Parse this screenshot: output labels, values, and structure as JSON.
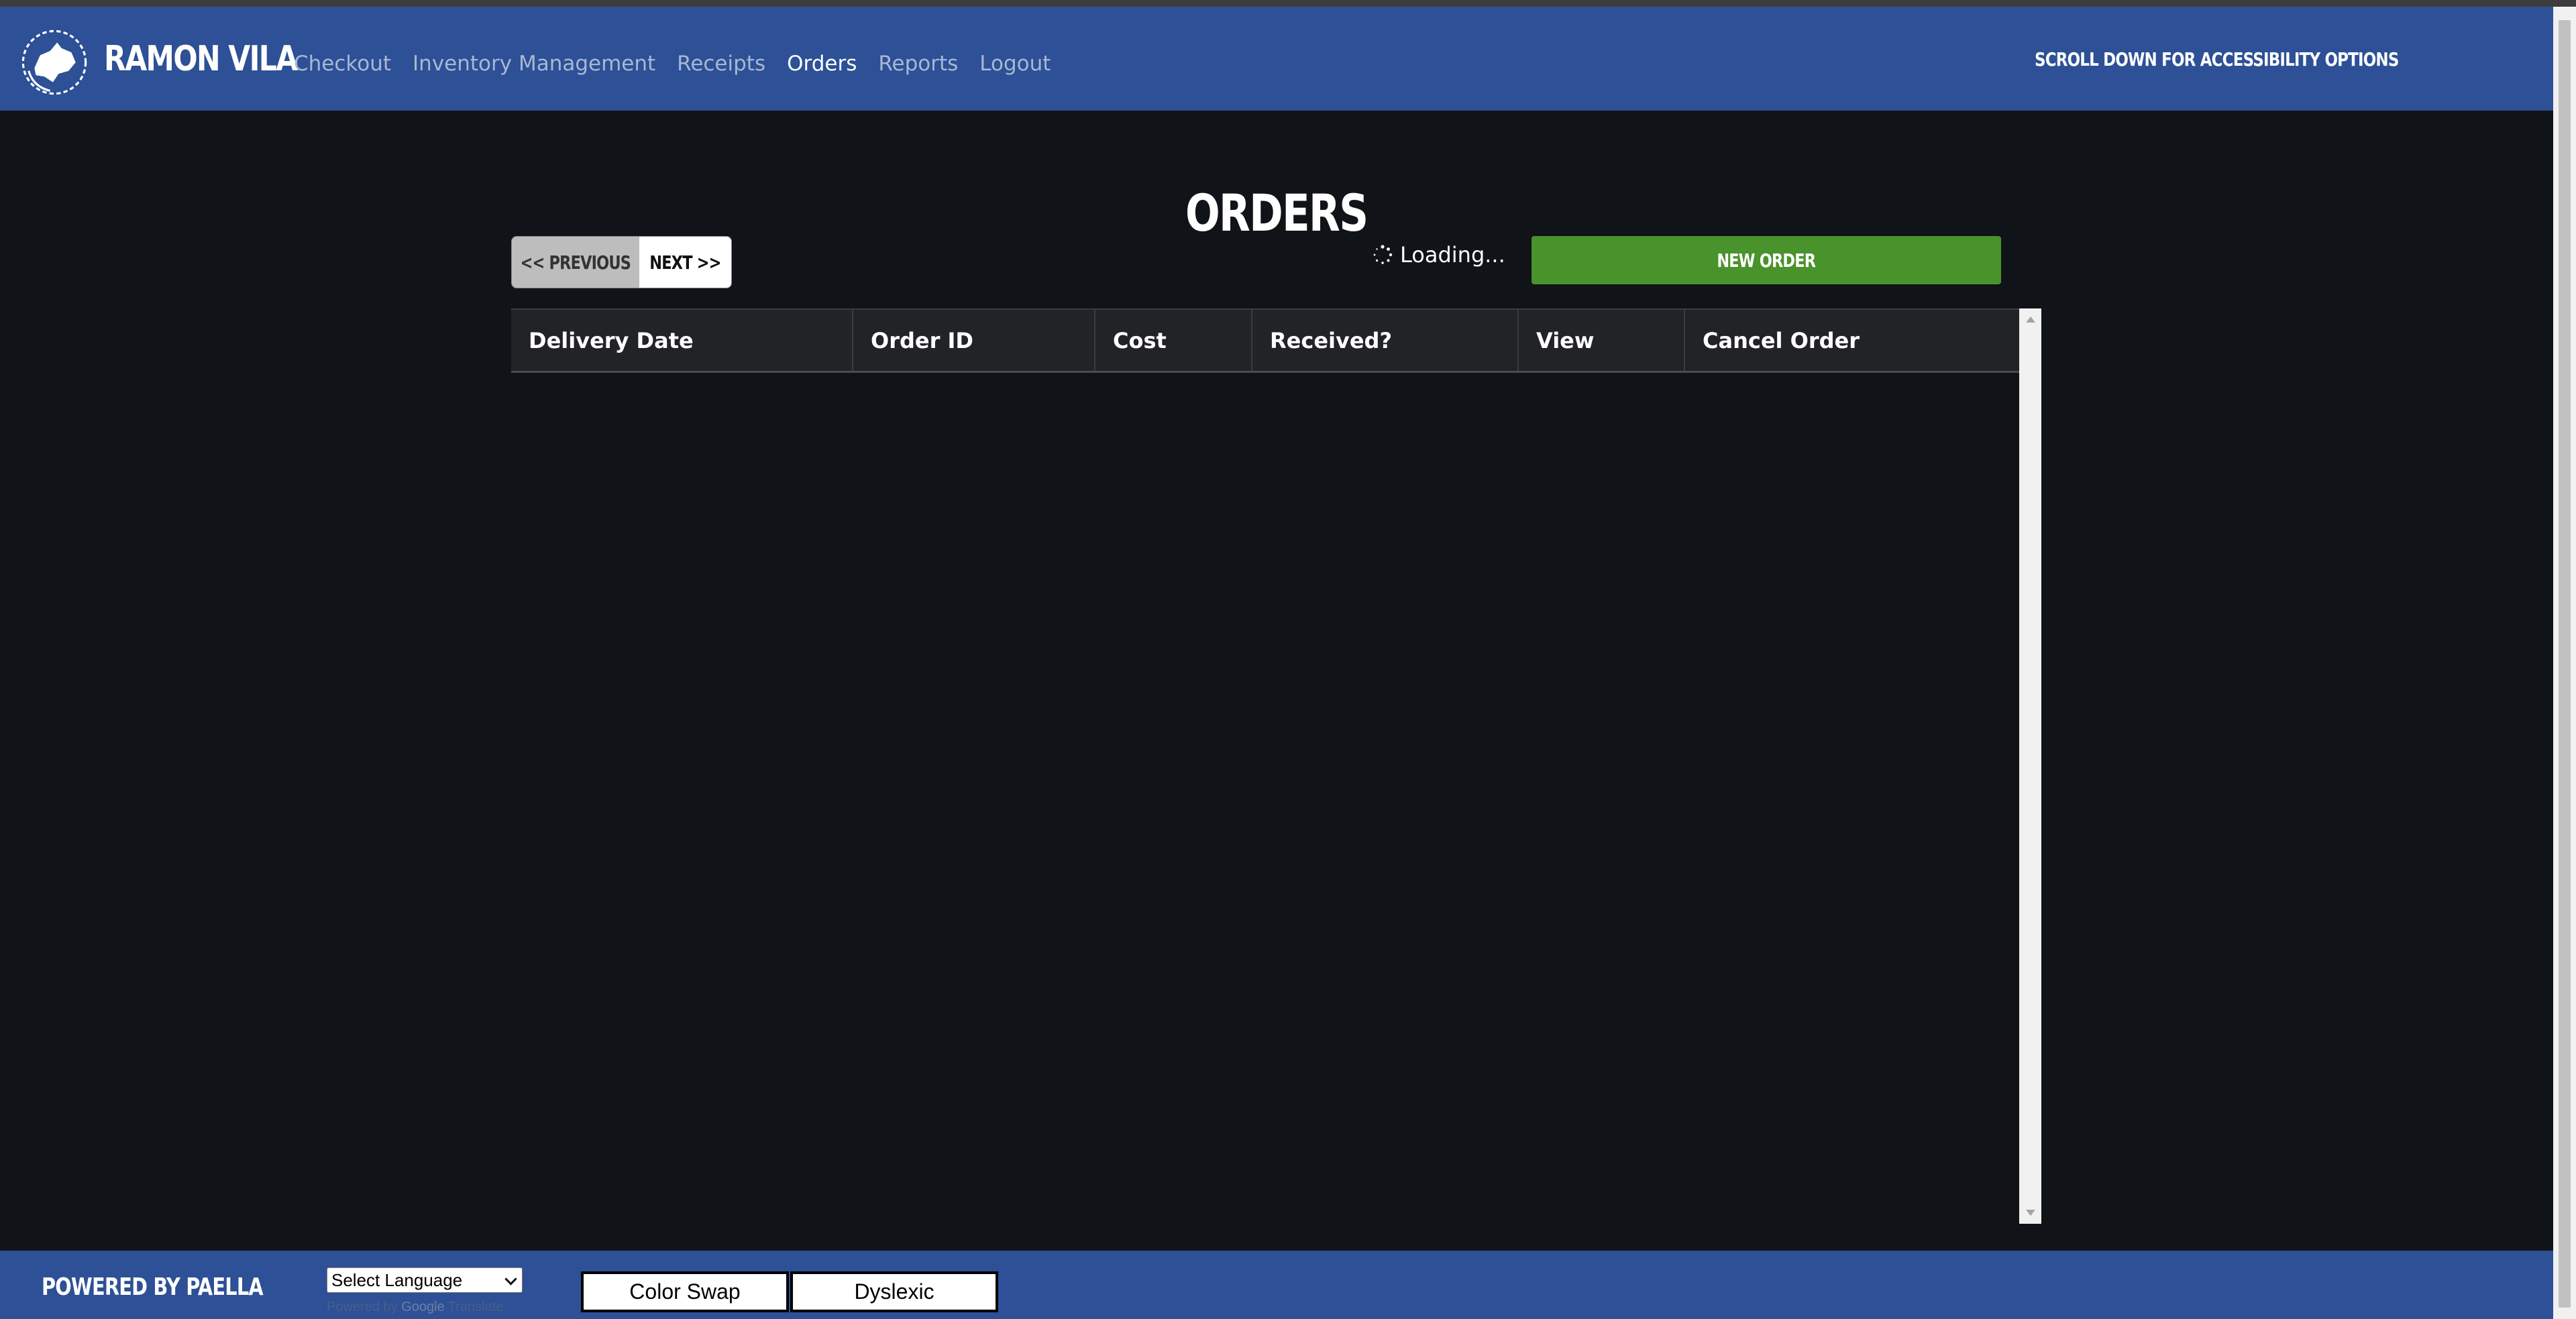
{
  "header": {
    "brand": "RAMON VILA",
    "nav": [
      "Checkout",
      "Inventory Management",
      "Receipts",
      "Orders",
      "Reports",
      "Logout"
    ],
    "active_nav": "Orders",
    "accessibility_note": "SCROLL DOWN FOR ACCESSIBILITY OPTIONS"
  },
  "main": {
    "title": "ORDERS",
    "prev_label": "<< PREVIOUS",
    "next_label": "NEXT >>",
    "loading_text": "Loading...",
    "new_order_label": "NEW ORDER",
    "columns": [
      "Delivery Date",
      "Order ID",
      "Cost",
      "Received?",
      "View",
      "Cancel Order"
    ]
  },
  "footer": {
    "powered_by": "POWERED BY PAELLA",
    "language_select": "Select Language",
    "translate_credit_prefix": "Powered by",
    "translate_credit_brand": "Google",
    "translate_credit_suffix": "Translate",
    "color_swap_label": "Color Swap",
    "dyslexic_label": "Dyslexic"
  },
  "colors": {
    "header_bg": "#2d5096",
    "page_bg": "#101317",
    "accent_green": "#4a922b",
    "table_header_bg": "#212327"
  },
  "icons": [
    "logo-icon",
    "loading-spinner-icon",
    "chevron-down-icon"
  ]
}
